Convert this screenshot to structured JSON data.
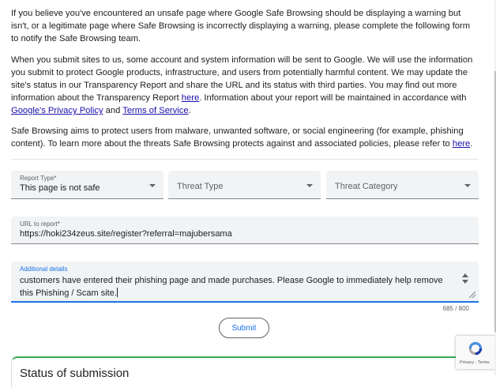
{
  "intro": {
    "para1": "If you believe you've encountered an unsafe page where Google Safe Browsing should be displaying a warning but isn't, or a legitimate page where Safe Browsing is incorrectly displaying a warning, please complete the following form to notify the Safe Browsing team.",
    "para2_part1": "When you submit sites to us, some account and system information will be sent to Google. We will use the information you submit to protect Google products, infrastructure, and users from potentially harmful content. We may update the site's status in our Transparency Report and share the URL and its status with third parties. You may find out more information about the Transparency Report ",
    "para2_link1": "here",
    "para2_part2": ". Information about your report will be maintained in accordance with ",
    "para2_link2": "Google's Privacy Policy",
    "para2_part3": " and ",
    "para2_link3": "Terms of Service",
    "para2_part4": ".",
    "para3_part1": "Safe Browsing aims to protect users from malware, unwanted software, or social engineering (for example, phishing content). To learn more about the threats Safe Browsing protects against and associated policies, please refer to ",
    "para3_link": "here",
    "para3_part2": "."
  },
  "form": {
    "report_type": {
      "label": "Report Type*",
      "value": "This page is not safe"
    },
    "threat_type": {
      "placeholder": "Threat Type"
    },
    "threat_category": {
      "placeholder": "Threat Category"
    },
    "url": {
      "label": "URL to report*",
      "value": "https://hoki234zeus.site/register?referral=majubersama"
    },
    "details": {
      "label": "Additional details",
      "value": "customers have entered their phishing page and made purchases. Please Google to immediately help remove this Phishing / Scam site."
    },
    "counter": "685 / 800",
    "submit_label": "Submit"
  },
  "status": {
    "title": "Status of submission"
  },
  "recaptcha": {
    "links": "Privacy - Terms"
  },
  "colors": {
    "accent": "#1a73e8",
    "link": "#1a0dab",
    "success": "#34a853",
    "field_bg": "#f1f3f4"
  }
}
